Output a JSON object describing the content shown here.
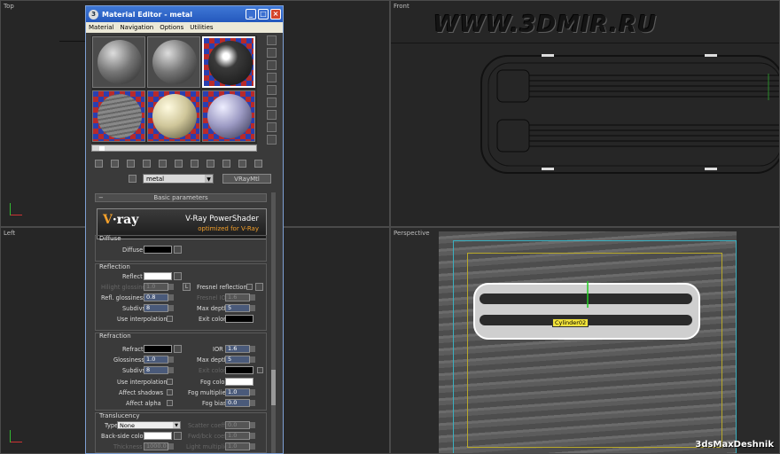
{
  "viewports": {
    "top": {
      "label": "Top"
    },
    "front": {
      "label": "Front"
    },
    "left": {
      "label": "Left"
    },
    "perspective": {
      "label": "Perspective",
      "object_tag": "Cylinder02"
    }
  },
  "watermark": "WWW.3DMIR.RU",
  "brand": "3dsMaxDeshnik",
  "material_editor": {
    "title": "Material Editor - metal",
    "window_buttons": [
      "_",
      "□",
      "×"
    ],
    "menu": [
      "Material",
      "Navigation",
      "Options",
      "Utilities"
    ],
    "material_name": "metal",
    "material_type": "VRayMtl",
    "rollout_title": "Basic parameters",
    "rollout_toggle": "−",
    "vray": {
      "logo_v": "V",
      "logo_rest": "·ray",
      "line1": "V-Ray PowerShader",
      "line2": "optimized for V-Ray"
    },
    "diffuse": {
      "group": "Diffuse",
      "label": "Diffuse",
      "color": "#000000"
    },
    "reflection": {
      "group": "Reflection",
      "reflect_label": "Reflect",
      "reflect_color": "#ffffff",
      "hilight_label": "Hilight glossiness",
      "hilight_value": "1.0",
      "hilight_lock": "L",
      "fresnel_label": "Fresnel reflections",
      "refl_gloss_label": "Refl. glossiness",
      "refl_gloss_value": "0.8",
      "fresnel_ior_label": "Fresnel IOR",
      "fresnel_ior_value": "1.6",
      "subdivs_label": "Subdivs",
      "subdivs_value": "8",
      "max_depth_label": "Max depth",
      "max_depth_value": "5",
      "use_interp_label": "Use interpolation",
      "exit_color_label": "Exit color",
      "exit_color": "#000000"
    },
    "refraction": {
      "group": "Refraction",
      "refract_label": "Refract",
      "refract_color": "#000000",
      "ior_label": "IOR",
      "ior_value": "1.6",
      "gloss_label": "Glossiness",
      "gloss_value": "1.0",
      "max_depth_label": "Max depth",
      "max_depth_value": "5",
      "subdivs_label": "Subdivs",
      "subdivs_value": "8",
      "exit_color_label": "Exit color",
      "exit_color": "#000000",
      "use_interp_label": "Use interpolation",
      "fog_color_label": "Fog color",
      "fog_color": "#ffffff",
      "affect_shadows_label": "Affect shadows",
      "fog_mult_label": "Fog multiplier",
      "fog_mult_value": "1.0",
      "affect_alpha_label": "Affect alpha",
      "fog_bias_label": "Fog bias",
      "fog_bias_value": "0.0"
    },
    "translucency": {
      "group": "Translucency",
      "type_label": "Type",
      "type_value": "None",
      "scatter_label": "Scatter coeff",
      "scatter_value": "0.0",
      "backside_label": "Back-side color",
      "fwdbck_label": "Fwd/bck coeff",
      "fwdbck_value": "1.0",
      "thickness_label": "Thickness",
      "thickness_value": "1000.0",
      "light_mult_label": "Light multiplier",
      "light_mult_value": "1.0"
    }
  }
}
